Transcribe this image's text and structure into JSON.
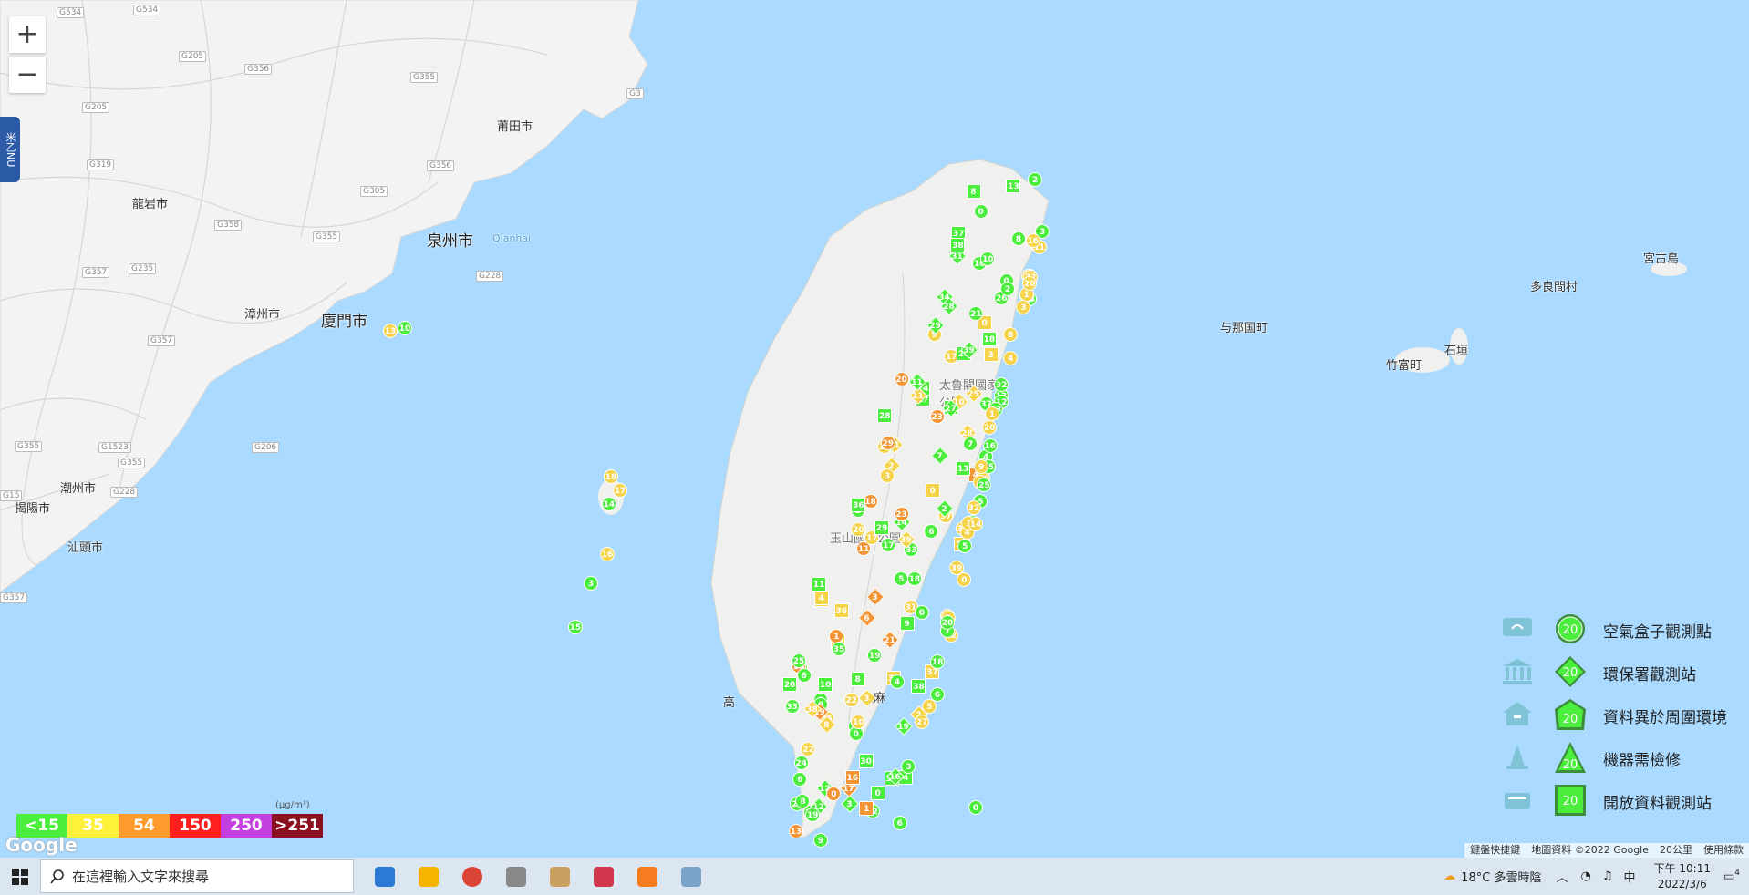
{
  "map": {
    "zoom_in": "+",
    "zoom_out": "−",
    "menu_tab": "米乙NU",
    "places": {
      "putian": "莆田市",
      "longyan": "龍岩市",
      "quanzhou": "泉州市",
      "quanzhou_en": "Qianhai",
      "zhangzhou": "漳州市",
      "xiamen": "廈門市",
      "chaozhou": "潮州市",
      "jieyang": "揭陽市",
      "shantou": "汕頭市",
      "taroko": "太魯閣國家公園",
      "yushan": "玉山國家公園",
      "yonaguni": "与那国町",
      "taketomi": "竹富町",
      "ishigaki": "石垣",
      "tarama": "多良間村",
      "miyakojima": "宮古島",
      "gao": "高",
      "taima": "太麻"
    },
    "roads": [
      "G534",
      "G534",
      "G205",
      "G356",
      "G355",
      "G3",
      "G205",
      "G319",
      "G356",
      "G305",
      "G358",
      "G235",
      "G355",
      "G357",
      "G228",
      "G357",
      "G355",
      "G1523",
      "G355",
      "G206",
      "G15",
      "G228",
      "G357"
    ]
  },
  "aqi_scale": {
    "unit": "(µg/m³)",
    "cells": [
      {
        "label": "<15",
        "color": "#4cee3d"
      },
      {
        "label": "35",
        "color": "#fff03a"
      },
      {
        "label": "54",
        "color": "#ff9a2c"
      },
      {
        "label": "150",
        "color": "#ff1f1f"
      },
      {
        "label": "250",
        "color": "#c43fe0"
      },
      {
        "label": ">251",
        "color": "#8b1020"
      }
    ]
  },
  "legend": [
    {
      "icon": "airbox-icon",
      "marker": "circle",
      "value": "20",
      "label": "空氣盒子觀測點"
    },
    {
      "icon": "epa-building-icon",
      "marker": "diamond",
      "value": "20",
      "label": "環保署觀測站"
    },
    {
      "icon": "house-icon",
      "marker": "pentagon",
      "value": "20",
      "label": "資料異於周圍環境"
    },
    {
      "icon": "cone-icon",
      "marker": "triangle",
      "value": "20",
      "label": "機器需檢修"
    },
    {
      "icon": "open-data-icon",
      "marker": "square",
      "value": "20",
      "label": "開放資料觀測站"
    }
  ],
  "google_logo": "Google",
  "attribution": {
    "shortcuts": "鍵盤快捷鍵",
    "mapdata": "地圖資料 ©2022 Google",
    "scale": "20公里",
    "terms": "使用條款"
  },
  "taskbar": {
    "search_placeholder": "在這裡輸入文字來搜尋",
    "weather": "18°C 多雲時陰",
    "ime": "中",
    "time": "下午 10:11",
    "date": "2022/3/6",
    "notification_count": "4",
    "app_colors": [
      "#2b7bd6",
      "#f4b400",
      "#db4437",
      "#888",
      "#c9a060",
      "#d0364c",
      "#f57c1f",
      "#7aa4c8"
    ]
  },
  "colors": {
    "green": "#4cee3d",
    "yellow": "#f5d34a",
    "orange": "#f39435",
    "red": "#e33a3a",
    "purple": "#b04ad9",
    "sea": "#aadaff",
    "land": "#f2f2f2"
  }
}
